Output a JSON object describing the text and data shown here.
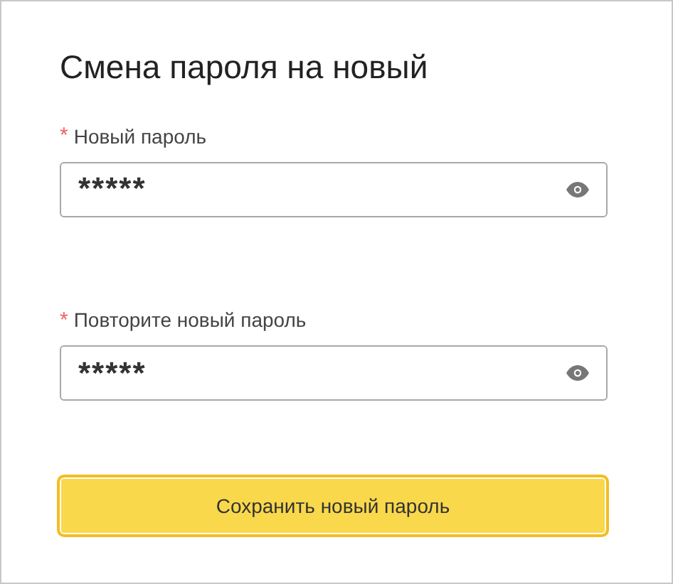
{
  "title": "Смена пароля на новый",
  "fields": [
    {
      "label": "Новый пароль",
      "required_mark": "*",
      "value": "*****"
    },
    {
      "label": "Повторите новый пароль",
      "required_mark": "*",
      "value": "*****"
    }
  ],
  "button": {
    "label": "Сохранить новый пароль",
    "focused": true
  }
}
